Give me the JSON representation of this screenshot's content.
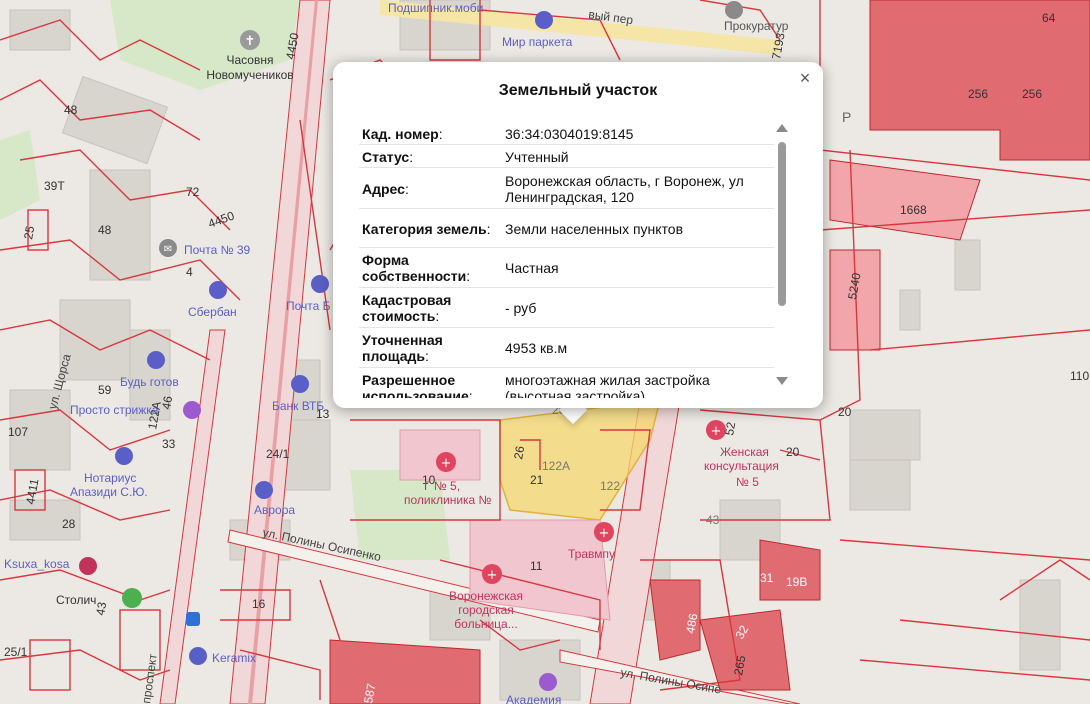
{
  "map": {
    "labels": {
      "chapel": [
        "Часовня",
        "Новомучеников"
      ],
      "podshipnik": "Подшипник.моби",
      "mir_parketa": "Мир паркета",
      "prokuratura": "Прокуратур",
      "pochta39": "Почта № 39",
      "sberbank": "Сбербан",
      "pochta_bank": "Почта Б",
      "bank_vtb": "Банк ВТБ",
      "bud_gotov": "Будь готов",
      "prosto_strizhka": "Просто стрижка",
      "notarius": [
        "Нотариус",
        "Апазиди С.Ю."
      ],
      "avrora": "Аврора",
      "ksuxa": "Ksuxa_kosa",
      "stolichny": "Столич",
      "keramix": "Keramix",
      "akademiya": "Академия",
      "polyclinic": [
        "Г № 5,",
        "поликлиника №"
      ],
      "travmpunkt": "Травмпу",
      "hospital": [
        "Воронежская",
        "городская",
        "больница..."
      ],
      "zhenskaya": [
        "Женская",
        "консультация",
        "№ 5"
      ],
      "street_shorsa": "ул. Щорса",
      "street_osipenko": "ул. Полины Осипенко",
      "street_osipenko2": "ул. Полины Осипе",
      "street_prosp": "проспект",
      "street_lane": "вый пер"
    },
    "numbers": {
      "n64": "64",
      "n256a": "256",
      "n256b": "256",
      "n1668": "1668",
      "n5240": "5240",
      "n110": "110",
      "n4450a": "4450",
      "n4450b": "4450",
      "n7193": "7193",
      "n48a": "48",
      "n48b": "48",
      "n72": "72",
      "n4": "4",
      "n25": "25",
      "n39t": "39Т",
      "n59": "59",
      "n46": "46",
      "n33": "33",
      "n122a_left": "122А",
      "n107": "107",
      "n24_1": "24/1",
      "n13": "13",
      "n4411": "4411",
      "n28": "28",
      "n25_1": "25/1",
      "n43a": "43",
      "n16": "16",
      "n10": "10",
      "n21": "21",
      "n26": "26",
      "n122A": "122А",
      "n122": "122",
      "n11": "11",
      "n52": "52",
      "n20a": "20",
      "n20b": "20",
      "n43b": "43",
      "n31": "31",
      "n198": "19В",
      "n486": "486",
      "n32": "32",
      "n265": "265",
      "n587": "587",
      "nP": "Р",
      "n26r": "26"
    }
  },
  "popup": {
    "title": "Земельный участок",
    "close_glyph": "×",
    "rows": [
      {
        "key": "Кад. номер",
        "value": "36:34:0304019:8145"
      },
      {
        "key": "Статус",
        "value": "Учтенный"
      },
      {
        "key": "Адрес",
        "value": "Воронежская область, г Воронеж, ул Ленинградская, 120"
      },
      {
        "key": "Категория земель",
        "value": "Земли населенных пунктов"
      },
      {
        "key": "Форма собственности",
        "value": "Частная"
      },
      {
        "key": "Кадастровая стоимость",
        "value": "- руб"
      },
      {
        "key": "Уточненная площадь",
        "value": "4953 кв.м"
      },
      {
        "key": "Разрешенное использование",
        "value": "многоэтажная жилая застройка (высотная застройка)"
      }
    ],
    "colon": ":"
  },
  "colors": {
    "cadastre_line": "#d9363e",
    "highlight_parcel": "#f5d76e",
    "building": "#d8d4ce",
    "red_building": "#e06c72",
    "major_road": "#e8a0a4",
    "poi": "#5a5fc7"
  }
}
